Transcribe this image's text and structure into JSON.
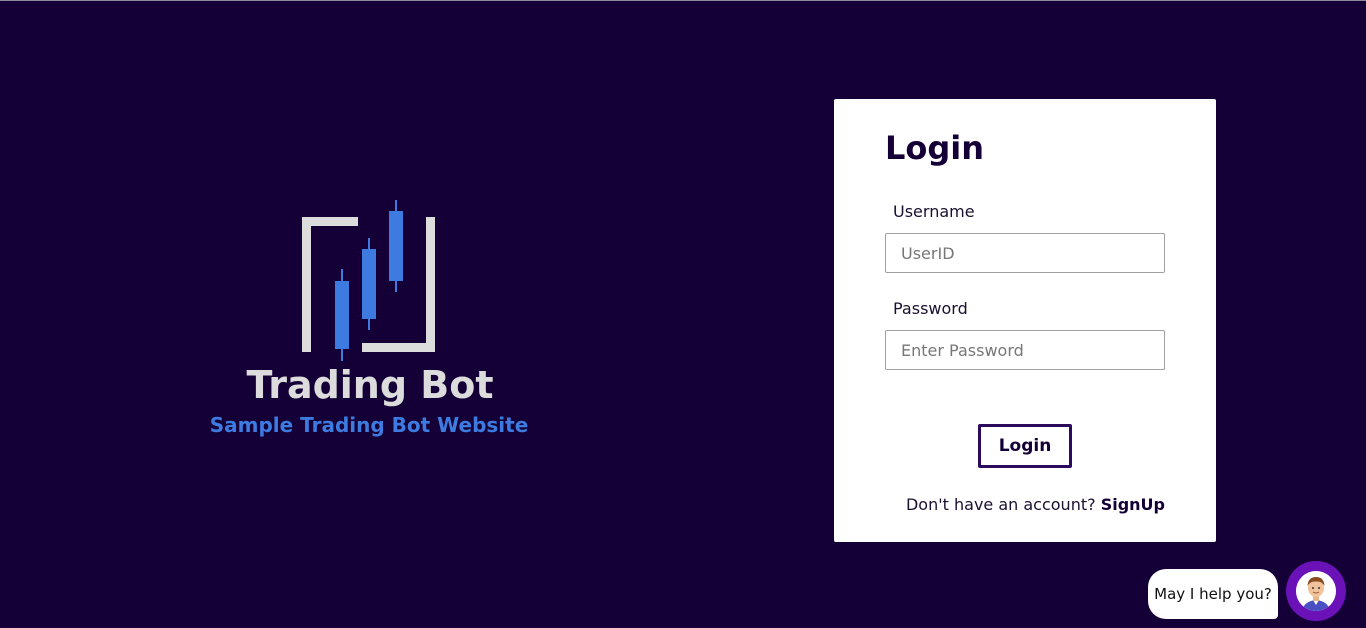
{
  "brand": {
    "title": "Trading Bot",
    "subtitle": "Sample Trading Bot Website",
    "colors": {
      "frame": "#dcdcdc",
      "candles": "#3d7be0"
    }
  },
  "login": {
    "title": "Login",
    "username_label": "Username",
    "username_placeholder": "UserID",
    "username_value": "",
    "password_label": "Password",
    "password_placeholder": "Enter Password",
    "password_value": "",
    "submit_label": "Login",
    "signup_prompt": "Don't have an account?",
    "signup_link": "SignUp"
  },
  "chat": {
    "bubble_text": "May I help you?",
    "avatar_icon": "assistant-avatar-icon"
  },
  "colors": {
    "background": "#140036",
    "card": "#ffffff",
    "accent": "#3d7be0",
    "button_border": "#2b0a5c",
    "chat_button": "#6a12b8"
  }
}
